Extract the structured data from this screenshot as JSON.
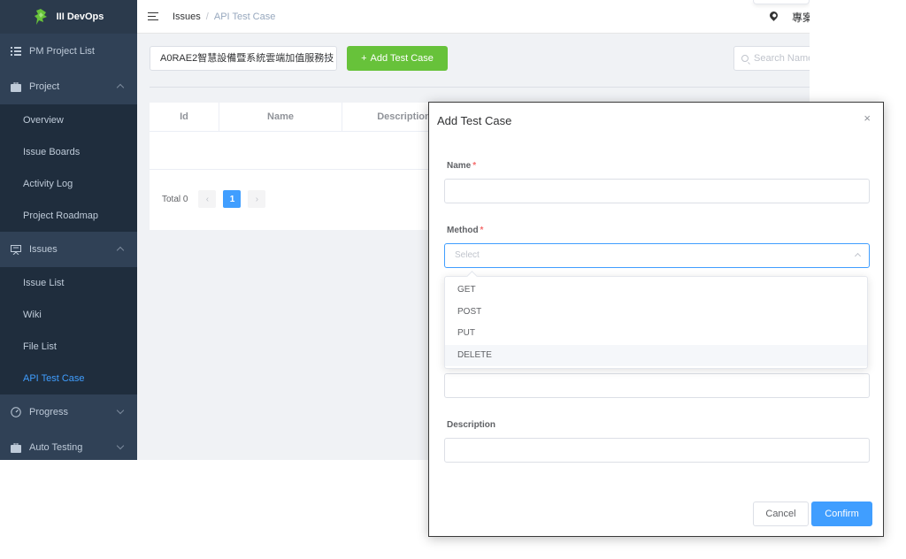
{
  "app": {
    "title": "III DevOps"
  },
  "sidebar": {
    "items": [
      {
        "label": "PM Project List"
      },
      {
        "label": "Project"
      },
      {
        "label": "Overview"
      },
      {
        "label": "Issue Boards"
      },
      {
        "label": "Activity Log"
      },
      {
        "label": "Project Roadmap"
      },
      {
        "label": "Issues"
      },
      {
        "label": "Issue List"
      },
      {
        "label": "Wiki"
      },
      {
        "label": "File List"
      },
      {
        "label": "API Test Case"
      },
      {
        "label": "Progress"
      },
      {
        "label": "Auto Testing"
      }
    ],
    "active_color": "#409eff"
  },
  "header": {
    "breadcrumb": {
      "parent": "Issues",
      "separator": "/",
      "current": "API Test Case"
    },
    "right_text": "專案"
  },
  "toolbar": {
    "project_select_value": "A0RAE2智慧設備暨系統雲端加值服務技",
    "add_button_label": "Add Test Case",
    "add_button_icon": "+",
    "search_placeholder": "Search Name"
  },
  "table": {
    "columns": [
      "Id",
      "Name",
      "Description"
    ]
  },
  "pagination": {
    "total_label": "Total 0",
    "prev": "‹",
    "current_page": "1",
    "next": "›"
  },
  "dialog": {
    "title": "Add Test Case",
    "close": "×",
    "fields": {
      "name_label": "Name",
      "method_label": "Method",
      "method_placeholder": "Select",
      "description_label": "Description",
      "required_mark": "*"
    },
    "method_options": [
      "GET",
      "POST",
      "PUT",
      "DELETE"
    ],
    "hovered_option": "DELETE",
    "cancel_label": "Cancel",
    "confirm_label": "Confirm"
  },
  "colors": {
    "primary": "#409eff",
    "success": "#67c23a",
    "sidebar_bg": "#304156",
    "sidebar_sub_bg": "#1f2d3d"
  }
}
